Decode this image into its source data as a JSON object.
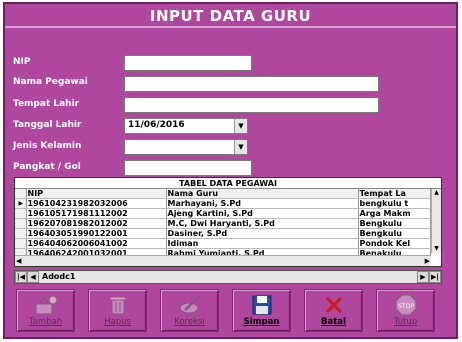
{
  "window": {
    "title": "INPUT DATA GURU"
  },
  "form": {
    "nip": {
      "label": "NIP",
      "value": ""
    },
    "nama": {
      "label": "Nama Pegawai",
      "value": ""
    },
    "tempat": {
      "label": "Tempat Lahir",
      "value": ""
    },
    "tanggal": {
      "label": "Tanggal Lahir",
      "value": "11/06/2016"
    },
    "jenis": {
      "label": "Jenis Kelamin",
      "value": ""
    },
    "pangkat": {
      "label": "Pangkat / Gol",
      "value": ""
    }
  },
  "grid": {
    "caption": "TABEL DATA PEGAWAI",
    "headers": [
      "NIP",
      "Nama Guru",
      "Tempat La"
    ],
    "rows": [
      [
        "196104231982032006",
        "Marhayani, S.Pd",
        "bengkulu t"
      ],
      [
        "196105171981112002",
        "Ajeng Kartini, S.Pd",
        "Arga Makm"
      ],
      [
        "196207081982012002",
        "M.C, Dwi Haryanti, S.Pd",
        "Bengkulu"
      ],
      [
        "196403051990122001",
        "Dasiner, S.Pd",
        "Bengkulu"
      ],
      [
        "196404062006041002",
        "Idiman",
        "Pondok Kel"
      ],
      [
        "196406242001032001",
        "Rahmi Yumianti. S.Pd",
        "Benakulu"
      ]
    ]
  },
  "adodc": {
    "caption": "Adodc1"
  },
  "buttons": {
    "tambah": "Tambah",
    "hapus": "Hapus",
    "koreksi": "Koreksi",
    "simpan": "Simpan",
    "batal": "Batal",
    "tutup": "Tutup"
  },
  "colors": {
    "form_bg": "#b0479e",
    "label_text": "#ffffff",
    "disabled_caption": "#5a2a50"
  },
  "icons": {
    "tambah": "add-record-icon",
    "hapus": "delete-trash-icon",
    "koreksi": "edit-pencil-icon",
    "simpan": "save-floppy-icon",
    "batal": "cancel-x-icon",
    "tutup": "stop-sign-icon"
  }
}
